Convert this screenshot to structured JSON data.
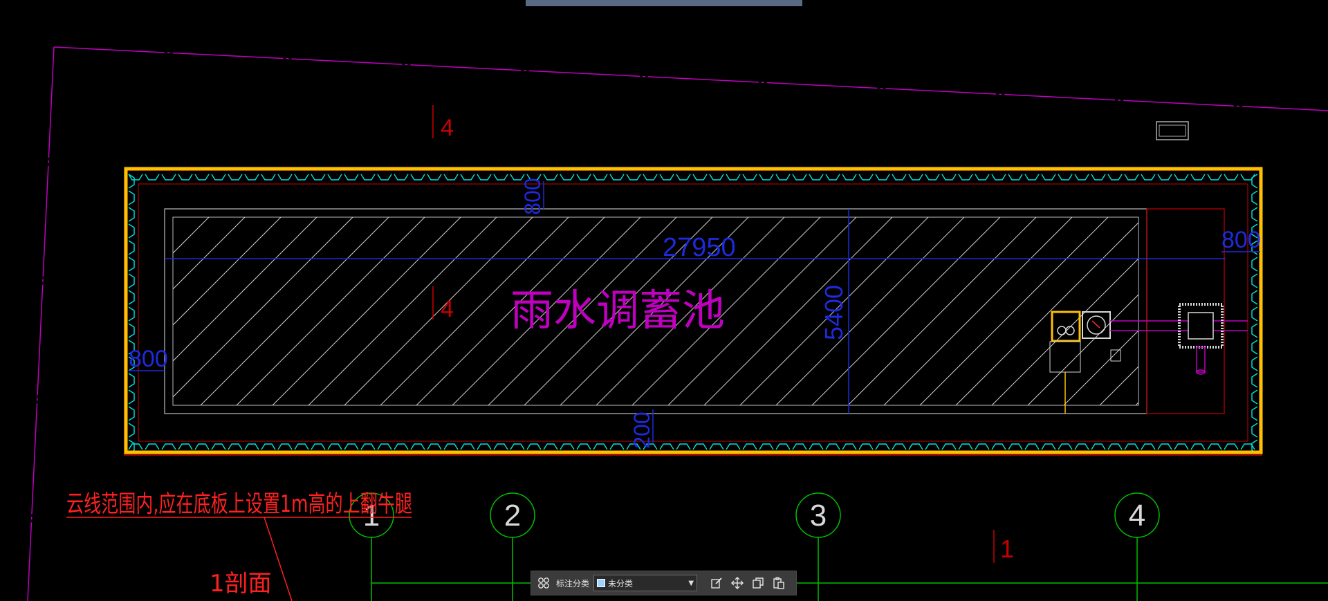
{
  "drawing": {
    "area_label": "雨水调蓄池",
    "dim_length": "27950",
    "dim_width": "5400",
    "dim_offset_top": "800",
    "dim_offset_bottom": "200",
    "dim_offset_left": "800",
    "dim_offset_right": "800",
    "section_mark_top": "4",
    "section_mark_mid": "4",
    "section_mark_bottom": "1",
    "note_text": "云线范围内,应在底板上设置1m高的上翻牛腿",
    "section_label": "1剖面",
    "grid_axes": [
      "1",
      "2",
      "3",
      "4"
    ],
    "colors": {
      "background": "#000000",
      "cloud_outline": "#ffc000",
      "revision_cloud": "#00e5e5",
      "wall_red": "#c80000",
      "hatch_white": "#d8d8d8",
      "dimension_blue": "#1e2adc",
      "text_magenta": "#c000c0",
      "grid_green": "#00c000",
      "note_red": "#ff2020"
    }
  },
  "annotation_toolbar": {
    "label": "标注分类",
    "selected_category": "未分类",
    "buttons": {
      "category_icon": "grid-icon",
      "edit_icon": "edit-icon",
      "move_icon": "move-icon",
      "copy_icon": "copy-icon",
      "paste_icon": "paste-icon"
    }
  }
}
